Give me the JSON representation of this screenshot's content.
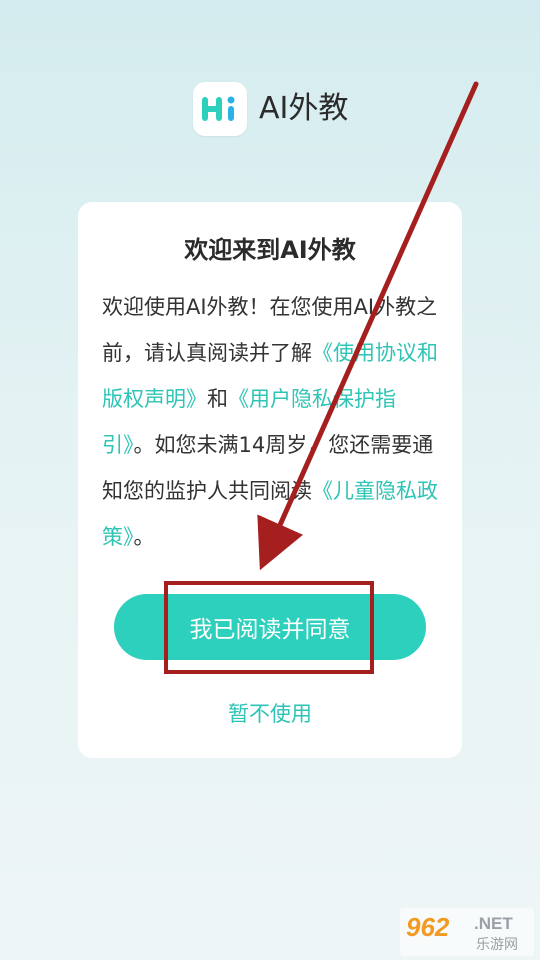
{
  "header": {
    "logo_text": "Hi",
    "app_name": "AI外教"
  },
  "dialog": {
    "title": "欢迎来到AI外教",
    "body_intro": "欢迎使用AI外教！在您使用AI外教之前，请认真阅读并了解",
    "link_terms": "《使用协议和版权声明》",
    "and_text": "和",
    "link_privacy": "《用户隐私保护指引》",
    "body_mid": "。如您未满14周岁，您还需要通知您的监护人共同阅读",
    "link_child": "《儿童隐私政策》",
    "body_end": "。",
    "agree_label": "我已阅读并同意",
    "decline_label": "暂不使用"
  },
  "watermark": {
    "big": "962",
    "net": ".NET",
    "cn": "乐游网"
  },
  "colors": {
    "accent": "#2dcfbd",
    "link": "#2ec4b6",
    "annotation_red": "#a61f1f"
  }
}
